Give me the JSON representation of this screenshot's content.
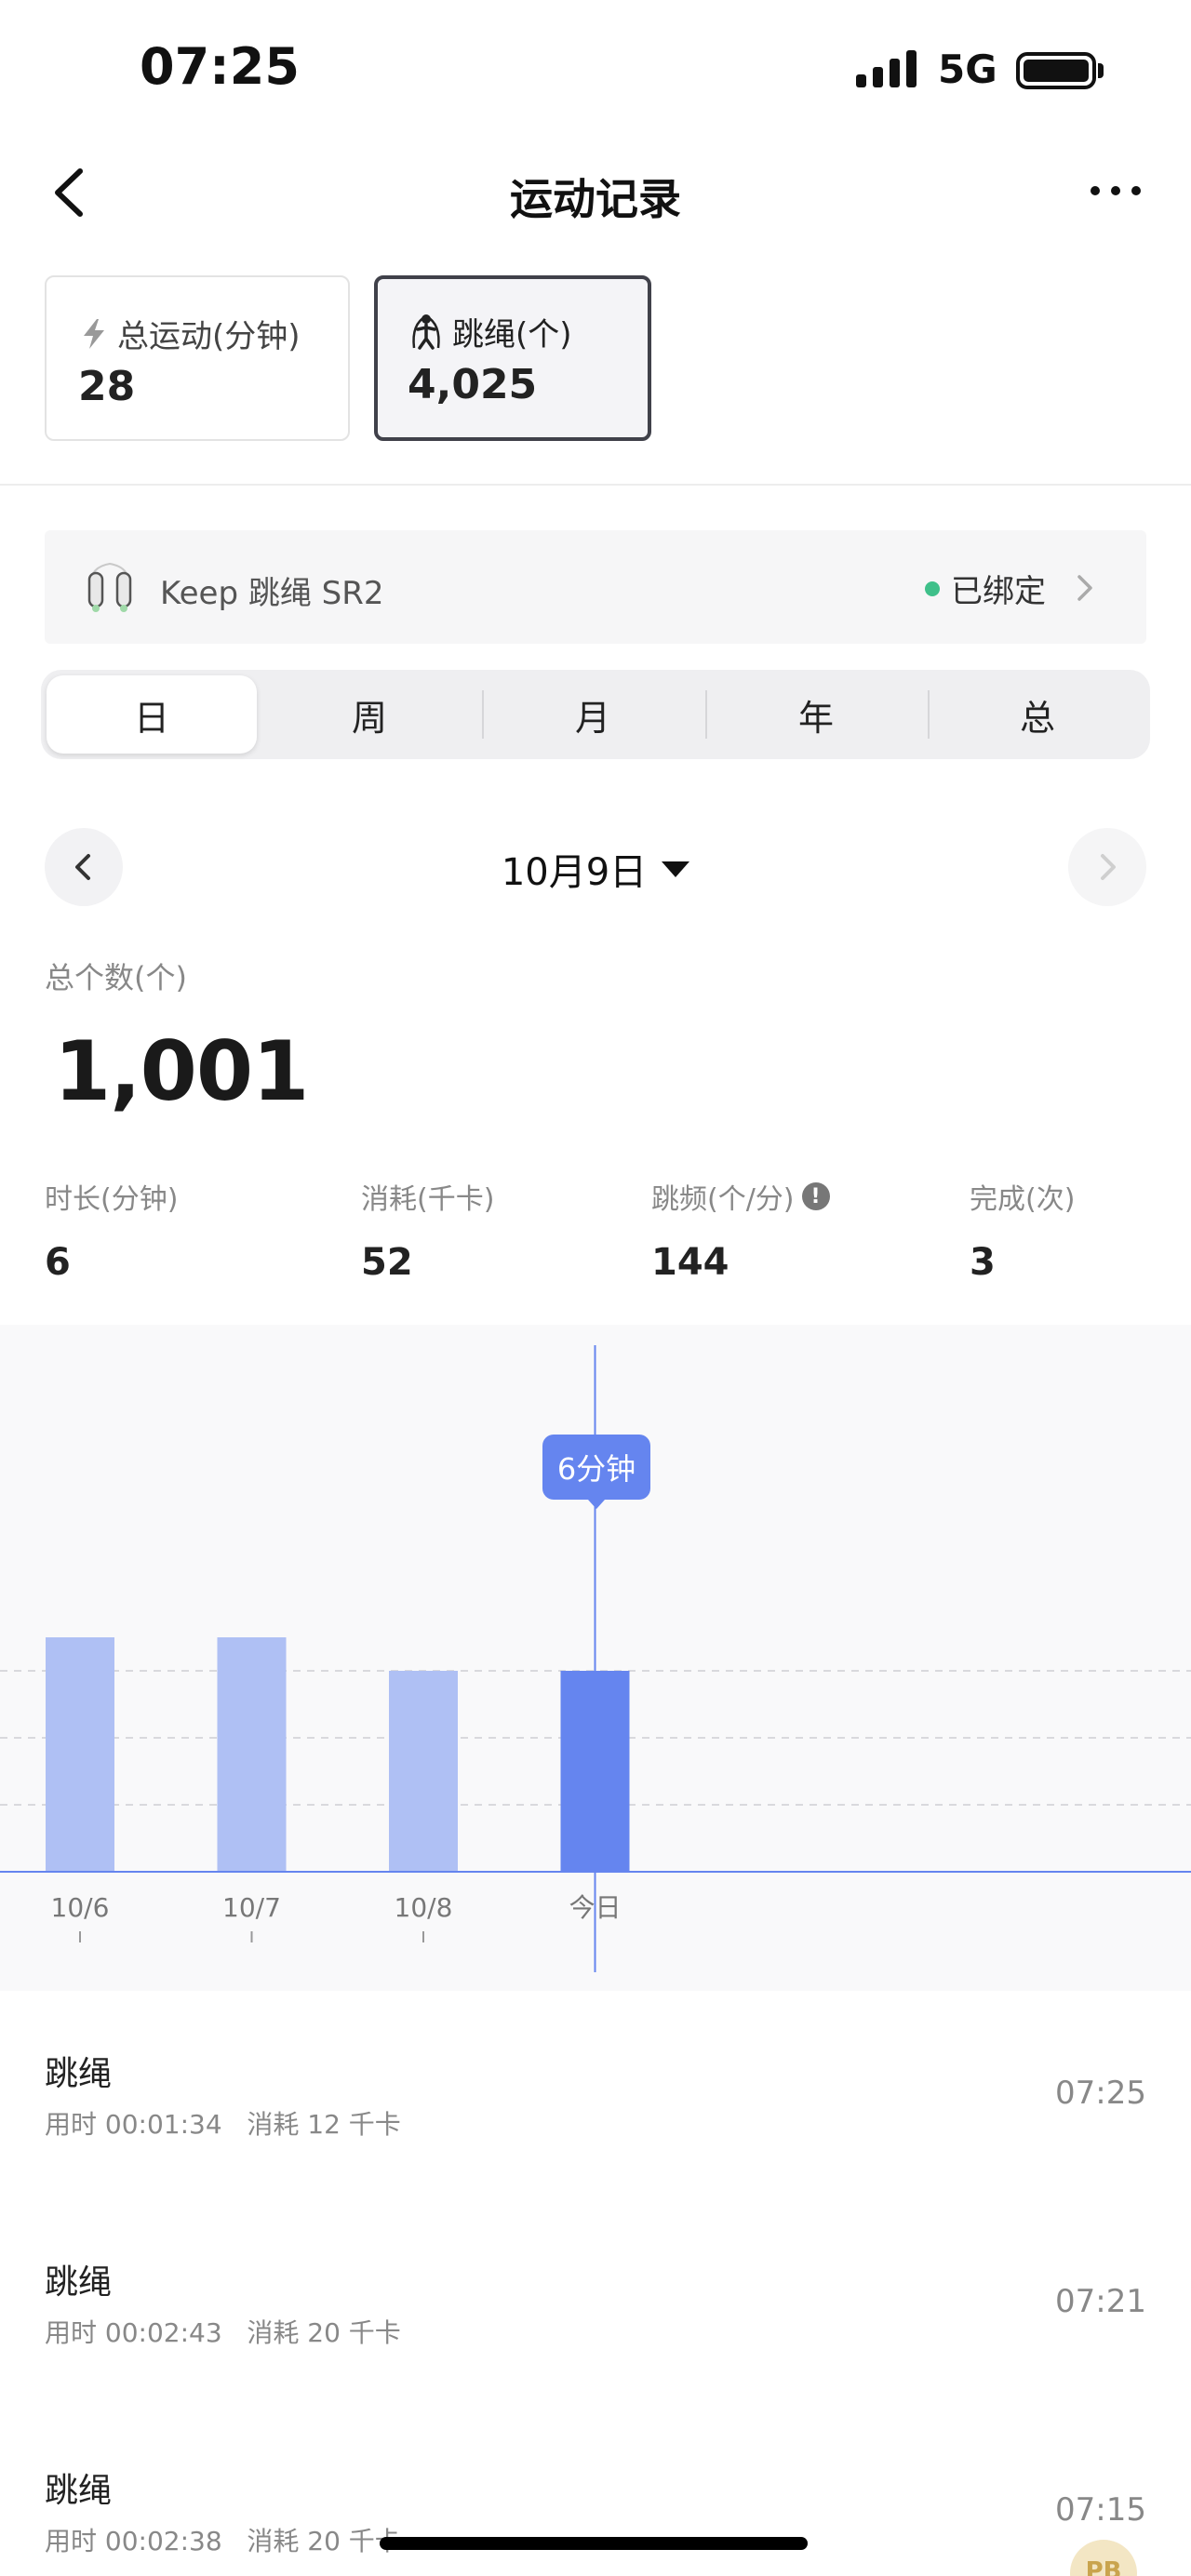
{
  "status_bar": {
    "time": "07:25",
    "network": "5G"
  },
  "nav": {
    "title": "运动记录"
  },
  "summary_cards": [
    {
      "label": "总运动(分钟)",
      "value": "28",
      "icon": "lightning-icon"
    },
    {
      "label": "跳绳(个)",
      "value": "4,025",
      "icon": "jump-rope-icon",
      "selected": true
    }
  ],
  "device": {
    "name": "Keep 跳绳 SR2",
    "status": "已绑定",
    "status_color": "#3fc08a"
  },
  "segments": [
    "日",
    "周",
    "月",
    "年",
    "总"
  ],
  "active_segment": "日",
  "date_nav": {
    "date": "10月9日"
  },
  "total": {
    "label": "总个数(个)",
    "value": "1,001"
  },
  "stats": [
    {
      "label": "时长(分钟)",
      "value": "6"
    },
    {
      "label": "消耗(千卡)",
      "value": "52"
    },
    {
      "label": "跳频(个/分)",
      "value": "144"
    },
    {
      "label": "完成(次)",
      "value": "3"
    }
  ],
  "chart_data": {
    "type": "bar",
    "categories": [
      "10/6",
      "10/7",
      "10/8",
      "今日"
    ],
    "values": [
      7,
      7,
      6,
      6
    ],
    "highlight_index": 3,
    "tooltip": "6分钟",
    "colors": {
      "bar": "#afc0f4",
      "bar_highlight": "#6585ef",
      "axis": "#6585ef"
    },
    "grid": true,
    "legend": "none"
  },
  "records": [
    {
      "title": "跳绳",
      "duration": "用时 00:01:34",
      "calories": "消耗 12 千卡",
      "time": "07:25"
    },
    {
      "title": "跳绳",
      "duration": "用时 00:02:43",
      "calories": "消耗 20 千卡",
      "time": "07:21"
    },
    {
      "title": "跳绳",
      "duration": "用时 00:02:38",
      "calories": "消耗 20 千卡",
      "time": "07:15"
    }
  ],
  "pr_badge": "PB"
}
